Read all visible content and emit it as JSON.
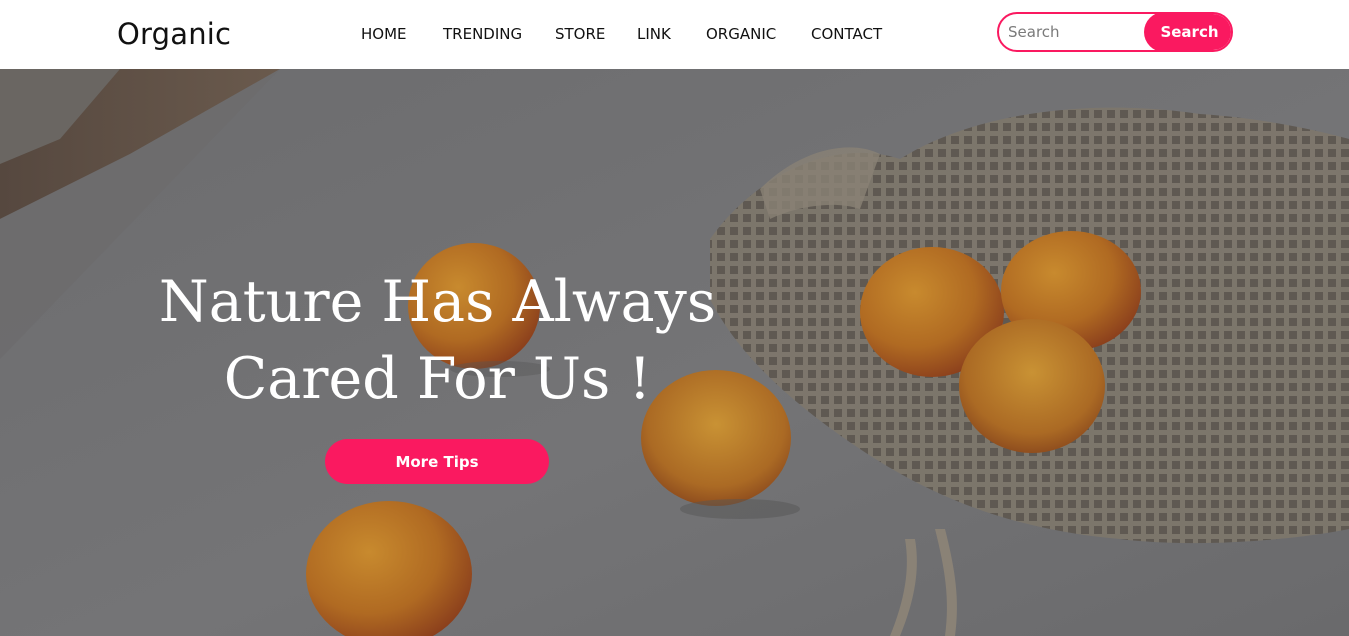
{
  "brand": {
    "name": "Organic"
  },
  "nav": {
    "links": [
      {
        "label": "HOME"
      },
      {
        "label": "TRENDING"
      },
      {
        "label": "STORE"
      },
      {
        "label": "LINK"
      },
      {
        "label": "ORGANIC"
      },
      {
        "label": "CONTACT"
      }
    ]
  },
  "search": {
    "placeholder": "Search",
    "value": "",
    "button_label": "Search"
  },
  "hero": {
    "title_line1": "Nature Has Always",
    "title_line2": "Cared For Us !",
    "button_label": "More Tips"
  },
  "colors": {
    "accent": "#fa1960",
    "nav_text": "#111111",
    "hero_text": "#ffffff"
  }
}
